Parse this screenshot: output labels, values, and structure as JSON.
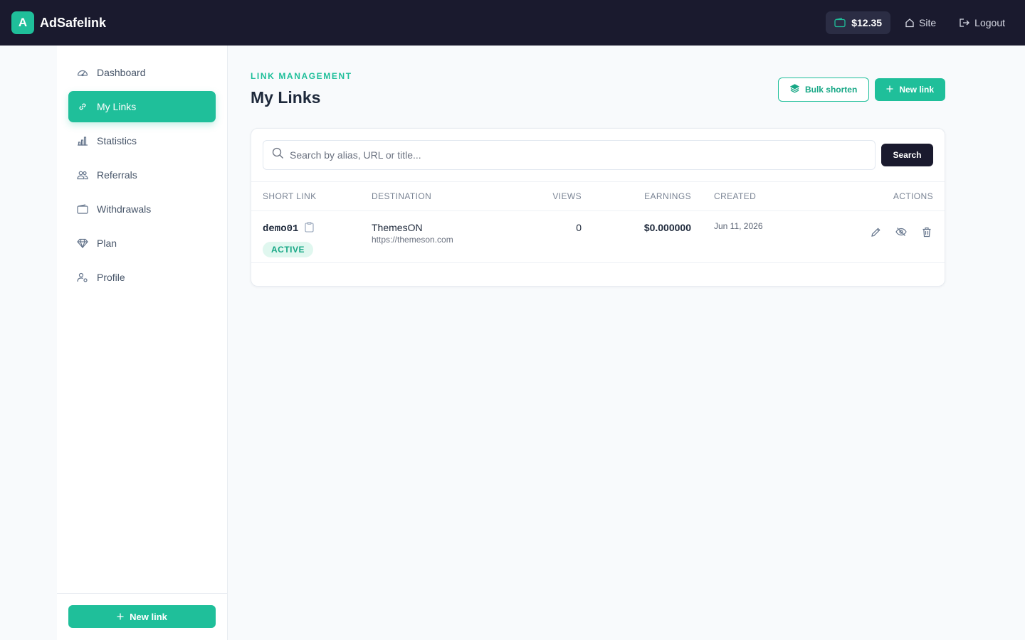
{
  "brand": {
    "logo_letter": "A",
    "name": "AdSafelink"
  },
  "topbar": {
    "balance": "$12.35",
    "site_label": "Site",
    "logout_label": "Logout"
  },
  "sidebar": {
    "items": [
      {
        "label": "Dashboard",
        "icon": "gauge-icon",
        "active": false
      },
      {
        "label": "My Links",
        "icon": "link-icon",
        "active": true
      },
      {
        "label": "Statistics",
        "icon": "bar-chart-icon",
        "active": false
      },
      {
        "label": "Referrals",
        "icon": "users-icon",
        "active": false
      },
      {
        "label": "Withdrawals",
        "icon": "wallet-icon",
        "active": false
      },
      {
        "label": "Plan",
        "icon": "diamond-icon",
        "active": false
      },
      {
        "label": "Profile",
        "icon": "user-gear-icon",
        "active": false
      }
    ],
    "new_link_label": "New link"
  },
  "header": {
    "kicker": "LINK MANAGEMENT",
    "title": "My Links",
    "bulk_label": "Bulk shorten",
    "new_link_label": "New link"
  },
  "search": {
    "placeholder": "Search by alias, URL or title...",
    "button_label": "Search"
  },
  "table": {
    "columns": [
      "SHORT LINK",
      "DESTINATION",
      "VIEWS",
      "EARNINGS",
      "CREATED",
      "ACTIONS"
    ],
    "rows": [
      {
        "alias": "demo01",
        "status": "ACTIVE",
        "dest_title": "ThemesON",
        "dest_url": "https://themeson.com",
        "views": "0",
        "earnings": "$0.000000",
        "created": "Jun 11, 2026"
      }
    ]
  },
  "colors": {
    "accent": "#1fbf9a",
    "topbar": "#1a1a2e"
  }
}
